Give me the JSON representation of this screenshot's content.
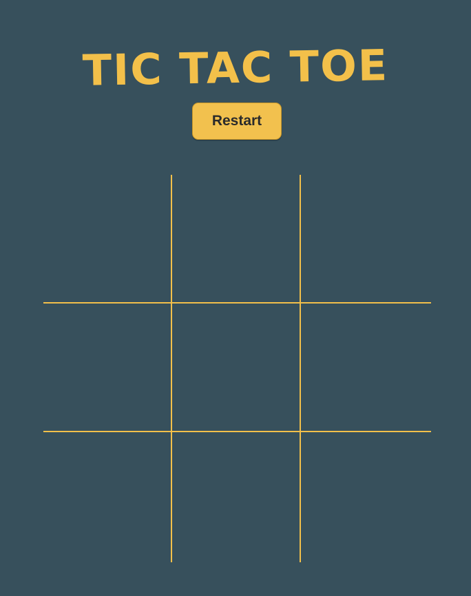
{
  "title": "TIC TAC TOE",
  "restart_label": "Restart",
  "colors": {
    "background": "#37505c",
    "accent": "#f3c04a",
    "button_text": "#2b2b2b"
  },
  "board": {
    "cells": [
      "",
      "",
      "",
      "",
      "",
      "",
      "",
      "",
      ""
    ]
  }
}
